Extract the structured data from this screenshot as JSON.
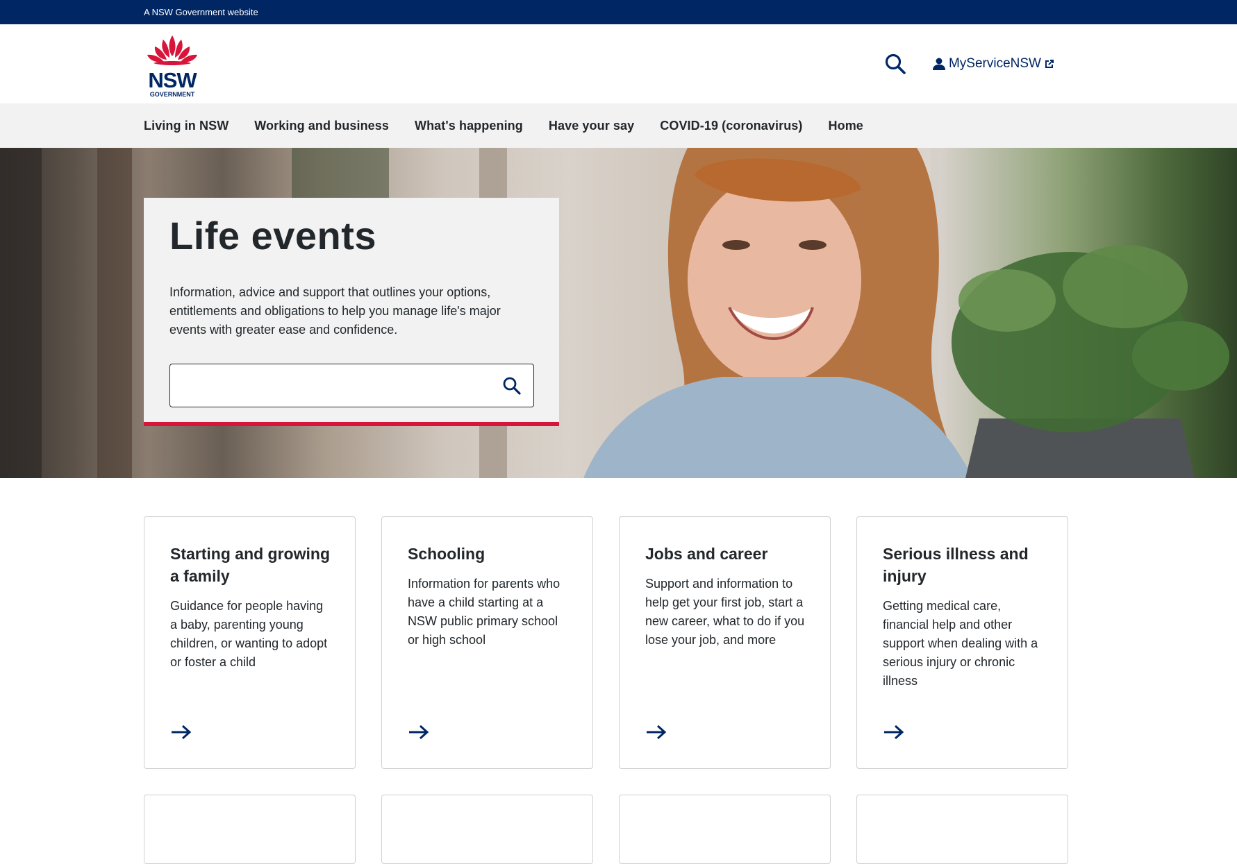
{
  "masthead": {
    "text": "A NSW Government website"
  },
  "header": {
    "logo_alt": "NSW Government",
    "logo_word": "NSW",
    "logo_sub": "GOVERNMENT",
    "account_link": "MyServiceNSW"
  },
  "nav": {
    "items": [
      {
        "label": "Living in NSW"
      },
      {
        "label": "Working and business"
      },
      {
        "label": "What's happening"
      },
      {
        "label": "Have your say"
      },
      {
        "label": "COVID-19 (coronavirus)"
      },
      {
        "label": "Home"
      }
    ]
  },
  "hero": {
    "title": "Life events",
    "intro": "Information, advice and support that outlines your options, entitlements and obligations to help you manage life's major events with greater ease and confidence.",
    "search_value": ""
  },
  "cards": [
    {
      "title": "Starting and growing a family",
      "desc": "Guidance for people having a baby, parenting young children, or wanting to adopt or foster a child"
    },
    {
      "title": "Schooling",
      "desc": "Information for parents who have a child starting at a NSW public primary school or high school"
    },
    {
      "title": "Jobs and career",
      "desc": "Support and information to help get your first job, start a new career, what to do if you lose your job, and more"
    },
    {
      "title": "Serious illness and injury",
      "desc": "Getting medical care, financial help and other support when dealing with a serious injury or chronic illness"
    }
  ],
  "colors": {
    "navy": "#002664",
    "red": "#d7153a",
    "nav_bg": "#f2f2f2",
    "text": "#22272b"
  }
}
